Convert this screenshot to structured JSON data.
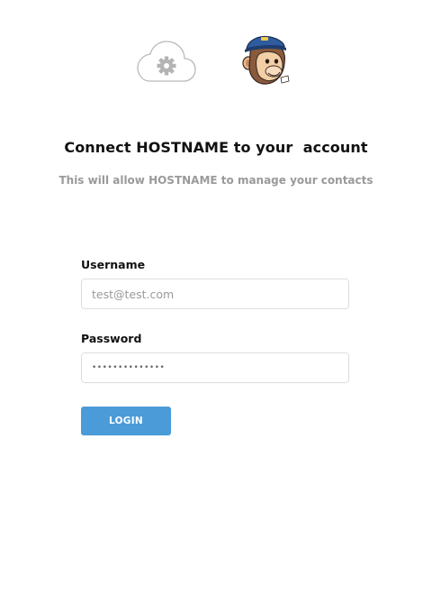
{
  "header": {
    "title": "Connect HOSTNAME to your  account",
    "subtitle": "This will allow HOSTNAME to manage your contacts"
  },
  "logos": {
    "left": "cloud-gear-icon",
    "right": "mailchimp-monkey-logo"
  },
  "form": {
    "username_label": "Username",
    "username_placeholder": "test@test.com",
    "username_value": "",
    "password_label": "Password",
    "password_value": "••••••••••••••",
    "login_label": "LOGIN"
  },
  "colors": {
    "accent": "#4a9bd8",
    "subtitle_text": "#9a9a9a",
    "border": "#dddddd"
  }
}
